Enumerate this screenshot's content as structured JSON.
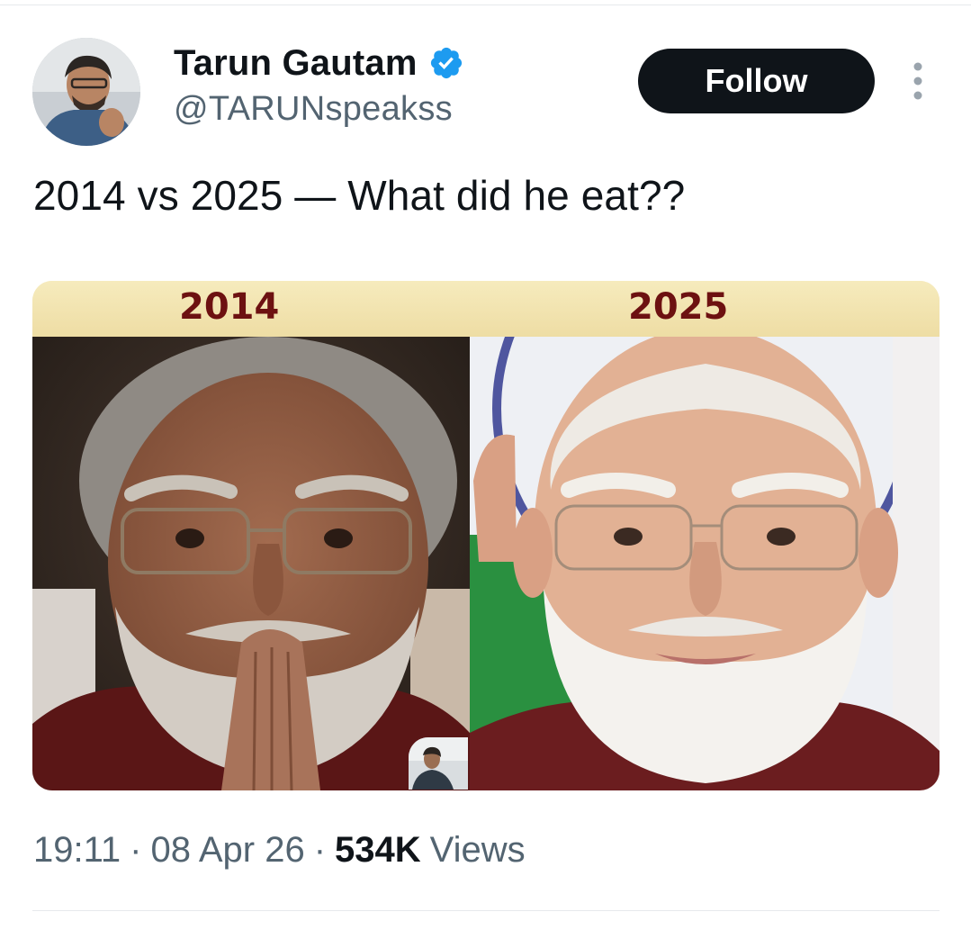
{
  "author": {
    "name": "Tarun Gautam",
    "handle": "@TARUNspeakss",
    "verified": true
  },
  "follow_label": "Follow",
  "tweet_text": "2014 vs 2025 — What did he eat??",
  "media": {
    "label_left": "2014",
    "label_right": "2025"
  },
  "meta": {
    "time": "19:11",
    "separator": "·",
    "date": "08 Apr 26",
    "views_count": "534K",
    "views_label": "Views"
  },
  "colors": {
    "text_primary": "#0f1419",
    "text_secondary": "#536471",
    "verified_blue": "#1d9bf0",
    "follow_bg": "#0f1419",
    "banner_bg": "#f3e6b6",
    "year_label": "#6d1111"
  },
  "icons": {
    "verified": "verified-badge-icon",
    "more": "more-vertical-icon"
  }
}
